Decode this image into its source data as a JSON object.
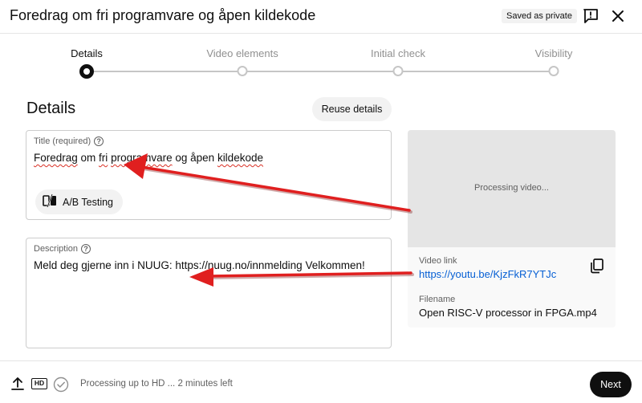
{
  "header": {
    "title": "Foredrag om fri programvare og åpen kildekode",
    "badge": "Saved as private"
  },
  "stepper": {
    "steps": [
      {
        "label": "Details",
        "active": true
      },
      {
        "label": "Video elements",
        "active": false
      },
      {
        "label": "Initial check",
        "active": false
      },
      {
        "label": "Visibility",
        "active": false
      }
    ]
  },
  "main": {
    "section_title": "Details",
    "reuse_label": "Reuse details",
    "title_field": {
      "label": "Title (required)",
      "value_parts": [
        "Foredrag",
        " om ",
        "fri",
        " ",
        "programvare",
        " og ",
        "åpen",
        " ",
        "kildekode"
      ]
    },
    "ab_label": "A/B Testing",
    "description_field": {
      "label": "Description",
      "value": "Meld deg gjerne inn i NUUG: https://nuug.no/innmelding Velkommen!"
    }
  },
  "preview": {
    "processing": "Processing video...",
    "link_label": "Video link",
    "link": "https://youtu.be/KjzFkR7YTJc",
    "filename_label": "Filename",
    "filename": "Open RISC-V processor in FPGA.mp4"
  },
  "footer": {
    "hd": "HD",
    "status": "Processing up to HD ... 2 minutes left",
    "next_label": "Next"
  },
  "colors": {
    "accent_link": "#065fd4",
    "annotation_arrow": "#e01f1f",
    "primary_button": "#0f0f0f"
  }
}
